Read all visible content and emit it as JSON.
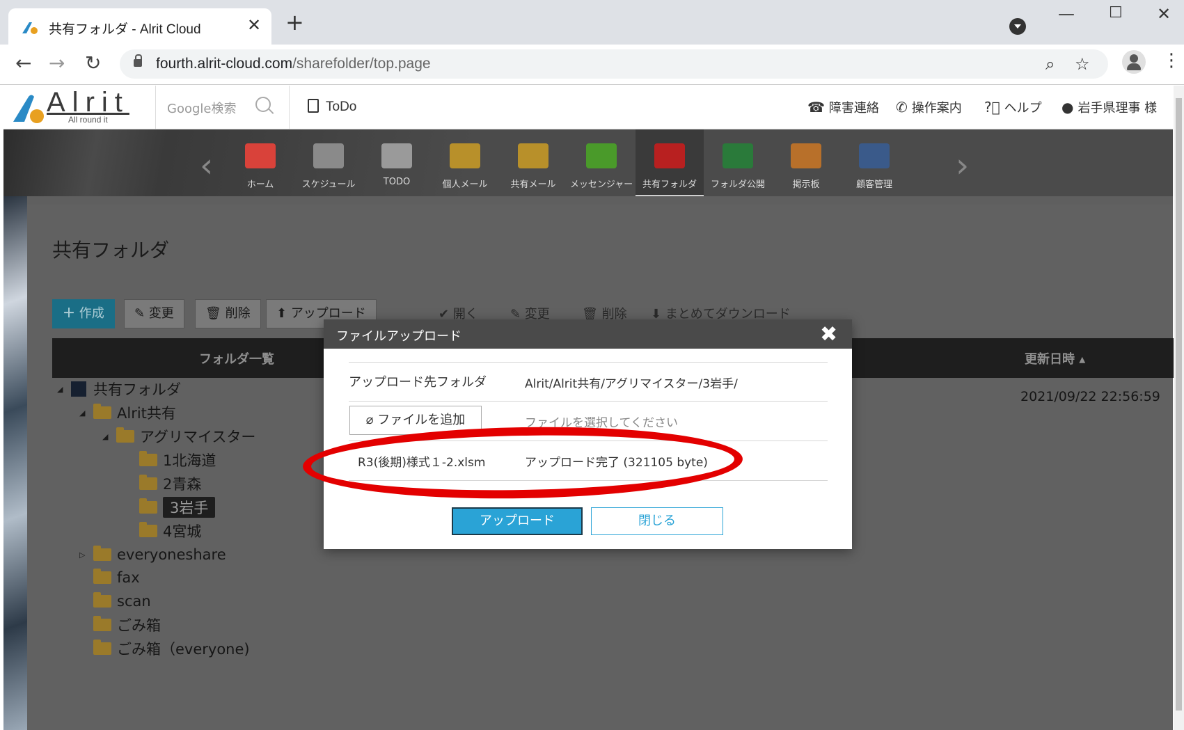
{
  "browser": {
    "tab_title": "共有フォルダ - Alrit Cloud",
    "url_host": "fourth.alrit-cloud.com",
    "url_path": "/sharefolder/top.page"
  },
  "header": {
    "logo_text": "Alrit",
    "logo_sub": "All round it",
    "search_placeholder": "Google検索",
    "todo_label": "ToDo",
    "links": [
      {
        "label": "障害連絡",
        "icon": "support-agent-icon"
      },
      {
        "label": "操作案内",
        "icon": "phone-icon"
      },
      {
        "label": "ヘルプ",
        "icon": "help-icon"
      },
      {
        "label": "岩手県理事 様",
        "icon": "user-icon"
      }
    ]
  },
  "nav": {
    "items": [
      {
        "label": "ホーム",
        "icon": "home-icon",
        "color": "#d9423a"
      },
      {
        "label": "スケジュール",
        "icon": "calendar-icon",
        "color": "#8a8a8a"
      },
      {
        "label": "TODO",
        "icon": "checklist-icon",
        "color": "#9a9a9a"
      },
      {
        "label": "個人メール",
        "icon": "mail-icon",
        "color": "#b8902a"
      },
      {
        "label": "共有メール",
        "icon": "shared-mail-icon",
        "color": "#b8902a"
      },
      {
        "label": "メッセンジャー",
        "icon": "messenger-icon",
        "color": "#4a9a2a"
      },
      {
        "label": "共有フォルダ",
        "icon": "shared-folder-icon",
        "color": "#b82020"
      },
      {
        "label": "フォルダ公開",
        "icon": "folder-public-icon",
        "color": "#2a7a3a"
      },
      {
        "label": "掲示板",
        "icon": "board-icon",
        "color": "#b8702a"
      },
      {
        "label": "顧客管理",
        "icon": "customer-icon",
        "color": "#3a5a8a"
      }
    ],
    "active_index": 6
  },
  "page": {
    "title": "共有フォルダ",
    "actions": [
      "作成",
      "変更",
      "削除",
      "アップロード"
    ],
    "file_actions": [
      "開く",
      "変更",
      "削除",
      "まとめてダウンロード"
    ],
    "col_folders": "フォルダ一覧",
    "col_updated": "更新日時",
    "tree": [
      {
        "label": "共有フォルダ",
        "toggle": "◢"
      },
      {
        "label": "Alrit共有",
        "toggle": "◢"
      },
      {
        "label": "アグリマイスター",
        "toggle": "◢"
      },
      {
        "label": "1北海道",
        "toggle": ""
      },
      {
        "label": "2青森",
        "toggle": ""
      },
      {
        "label": "3岩手",
        "toggle": ""
      },
      {
        "label": "4宮城",
        "toggle": ""
      },
      {
        "label": "everyoneshare",
        "toggle": "▷"
      },
      {
        "label": "fax",
        "toggle": ""
      },
      {
        "label": "scan",
        "toggle": ""
      },
      {
        "label": "ごみ箱",
        "toggle": ""
      },
      {
        "label": "ごみ箱（everyone)",
        "toggle": ""
      }
    ],
    "updated_at": "2021/09/22 22:56:59"
  },
  "dialog": {
    "title": "ファイルアップロード",
    "dest_label": "アップロード先フォルダ",
    "dest_value": "Alrit/Alrit共有/アグリマイスター/3岩手/",
    "add_file_label": "ファイルを追加",
    "add_file_placeholder": "ファイルを選択してください",
    "file_name": "R3(後期)様式１-2.xlsm",
    "file_status": "アップロード完了 (321105 byte)",
    "upload_button": "アップロード",
    "close_button": "閉じる"
  }
}
